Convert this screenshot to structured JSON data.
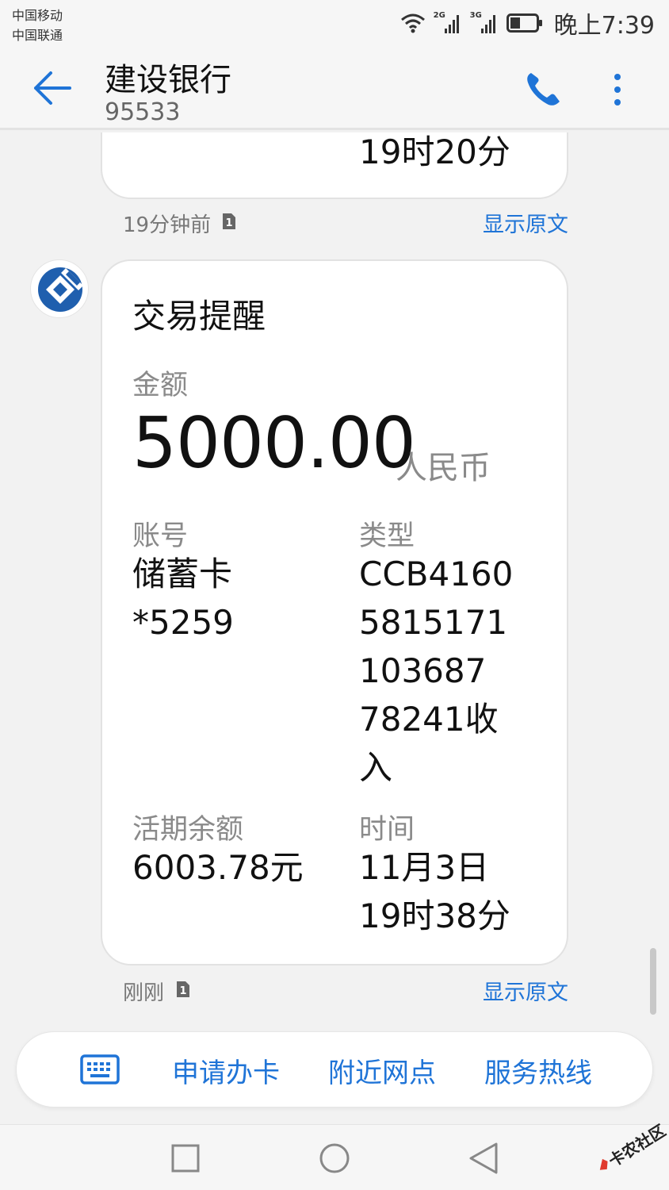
{
  "status_bar": {
    "carrier_1": "中国移动",
    "carrier_2": "中国联通",
    "signal_1_label": "2G",
    "signal_2_label": "3G",
    "time": "晚上7:39"
  },
  "header": {
    "title": "建设银行",
    "number": "95533",
    "icons": [
      "back-arrow-icon",
      "phone-icon",
      "more-vertical-icon"
    ],
    "accent_color": "#1f74d7"
  },
  "previous_message": {
    "visible_tail": "19时20分",
    "time_ago": "19分钟前",
    "sim": "1",
    "show_original": "显示原文"
  },
  "transaction_card": {
    "title": "交易提醒",
    "amount_label": "金额",
    "amount": "5000.00",
    "currency": "人民币",
    "account_label": "账号",
    "account_lines": [
      "储蓄卡",
      "*5259"
    ],
    "type_label": "类型",
    "type_lines": [
      "CCB4160",
      "5815171",
      "103687",
      "78241收",
      "入"
    ],
    "balance_label": "活期余额",
    "balance": "6003.78元",
    "time_label": "时间",
    "time_lines": [
      "11月3日",
      "19时38分"
    ],
    "time_ago": "刚刚",
    "sim": "1",
    "show_original": "显示原文"
  },
  "quick_menu": {
    "items": [
      "申请办卡",
      "附近网点",
      "服务热线"
    ]
  },
  "watermark": {
    "text": "卡农社区"
  }
}
